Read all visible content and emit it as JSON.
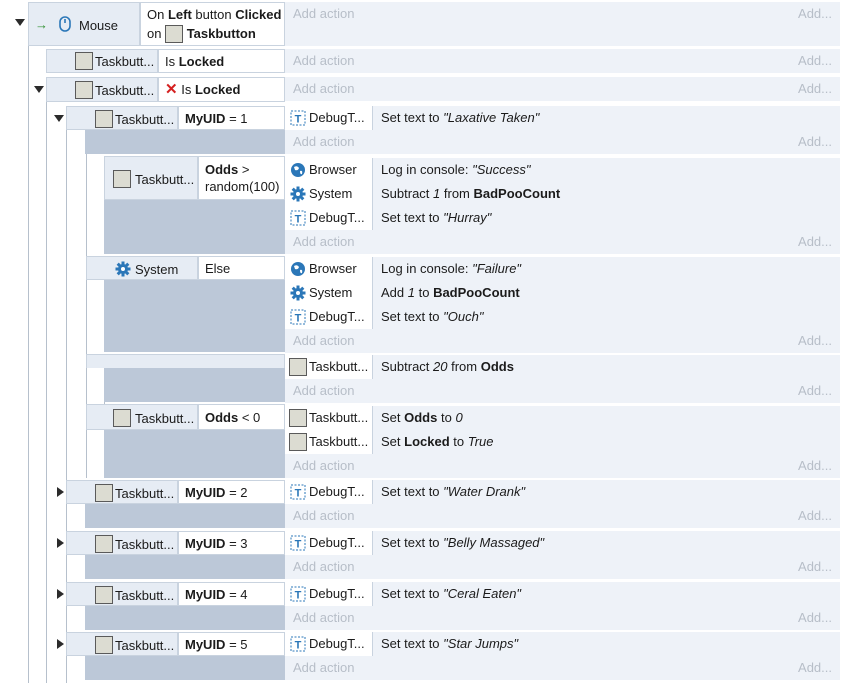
{
  "add_action": "Add action",
  "add_short": "Add...",
  "event1": {
    "object": "Mouse",
    "cond_line1_a": "On ",
    "cond_line1_b": "Left",
    "cond_line1_c": " button ",
    "cond_line1_d": "Clicked",
    "cond_line2_a": "on ",
    "cond_line2_b": "Taskbutton"
  },
  "sub1": {
    "object": "Taskbutt...",
    "cond_a": "Is ",
    "cond_b": "Locked"
  },
  "sub2": {
    "object": "Taskbutt...",
    "cond_a": "Is ",
    "cond_b": "Locked",
    "inverted_icon": "red-x-icon"
  },
  "uid_events": [
    {
      "object": "Taskbutt...",
      "var": "MyUID",
      "op": " = ",
      "val": "1",
      "act_object": "DebugT...",
      "act_a": "Set text to ",
      "act_b": "\"Laxative Taken\""
    },
    {
      "object": "Taskbutt...",
      "var": "MyUID",
      "op": " = ",
      "val": "2",
      "act_object": "DebugT...",
      "act_a": "Set text to ",
      "act_b": "\"Water Drank\""
    },
    {
      "object": "Taskbutt...",
      "var": "MyUID",
      "op": " = ",
      "val": "3",
      "act_object": "DebugT...",
      "act_a": "Set text to ",
      "act_b": "\"Belly Massaged\""
    },
    {
      "object": "Taskbutt...",
      "var": "MyUID",
      "op": " = ",
      "val": "4",
      "act_object": "DebugT...",
      "act_a": "Set text to ",
      "act_b": "\"Ceral Eaten\""
    },
    {
      "object": "Taskbutt...",
      "var": "MyUID",
      "op": " = ",
      "val": "5",
      "act_object": "DebugT...",
      "act_a": "Set text to ",
      "act_b": "\"Star Jumps\""
    }
  ],
  "odds_event": {
    "object": "Taskbutt...",
    "cond_a": "Odds",
    "cond_b": " >",
    "cond_c": "random(100)",
    "actions": [
      {
        "object": "Browser",
        "icon": "globe-icon",
        "a": "Log in console: ",
        "b": "\"Success\"",
        "c": ""
      },
      {
        "object": "System",
        "icon": "gear-icon",
        "a": "Subtract ",
        "b": "1",
        "c": " from ",
        "d": "BadPooCount"
      },
      {
        "object": "DebugT...",
        "icon": "text-object-icon",
        "a": "Set text to ",
        "b": "\"Hurray\""
      }
    ]
  },
  "else_event": {
    "object": "System",
    "cond": "Else",
    "actions": [
      {
        "object": "Browser",
        "icon": "globe-icon",
        "a": "Log in console: ",
        "b": "\"Failure\""
      },
      {
        "object": "System",
        "icon": "gear-icon",
        "a": "Add ",
        "b": "1",
        "c": " to ",
        "d": "BadPooCount"
      },
      {
        "object": "DebugT...",
        "icon": "text-object-icon",
        "a": "Set text to ",
        "b": "\"Ouch\""
      }
    ]
  },
  "blank_event": {
    "actions": [
      {
        "object": "Taskbutt...",
        "a": "Subtract ",
        "b": "20",
        "c": " from ",
        "d": "Odds"
      }
    ]
  },
  "lock_event": {
    "object": "Taskbutt...",
    "cond_a": "Odds",
    "cond_b": " < 0",
    "actions": [
      {
        "object": "Taskbutt...",
        "a": "Set ",
        "b": "Odds",
        "c": " to ",
        "d": "0"
      },
      {
        "object": "Taskbutt...",
        "a": "Set ",
        "b": "Locked",
        "c": " to ",
        "d": "True"
      }
    ]
  }
}
